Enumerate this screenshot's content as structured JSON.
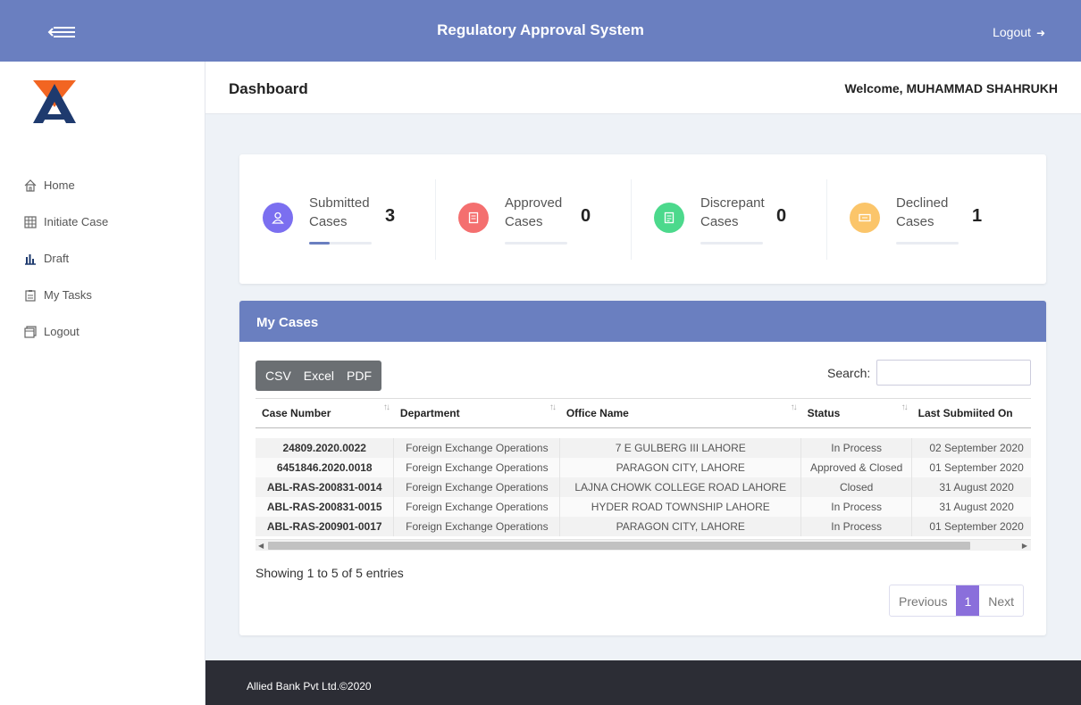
{
  "header": {
    "title": "Regulatory Approval System",
    "logout_label": "Logout"
  },
  "sidebar": {
    "items": [
      {
        "label": "Home",
        "icon": "home-icon"
      },
      {
        "label": "Initiate Case",
        "icon": "grid-icon"
      },
      {
        "label": "Draft",
        "icon": "bar-chart-icon"
      },
      {
        "label": "My Tasks",
        "icon": "clipboard-icon"
      },
      {
        "label": "Logout",
        "icon": "window-icon"
      }
    ]
  },
  "page": {
    "title": "Dashboard",
    "welcome": "Welcome, MUHAMMAD SHAHRUKH"
  },
  "stats": [
    {
      "line1": "Submitted",
      "line2": "Cases",
      "value": "3",
      "color": "#7b6ff0",
      "progress": 0.33
    },
    {
      "line1": "Approved",
      "line2": "Cases",
      "value": "0",
      "color": "#f46f6f",
      "progress": 0
    },
    {
      "line1": "Discrepant",
      "line2": "Cases",
      "value": "0",
      "color": "#4cd98c",
      "progress": 0
    },
    {
      "line1": "Declined",
      "line2": "Cases",
      "value": "1",
      "color": "#fbc56a",
      "progress": 0
    }
  ],
  "cases": {
    "title": "My Cases",
    "export_buttons": [
      "CSV",
      "Excel",
      "PDF"
    ],
    "search_label": "Search:",
    "search_value": "",
    "columns": [
      "Case Number",
      "Department",
      "Office Name",
      "Status",
      "Last Submiited On"
    ],
    "rows": [
      [
        "24809.2020.0022",
        "Foreign Exchange Operations",
        "7 E GULBERG III LAHORE",
        "In Process",
        "02 September 2020"
      ],
      [
        "6451846.2020.0018",
        "Foreign Exchange Operations",
        "PARAGON CITY, LAHORE",
        "Approved & Closed",
        "01 September 2020"
      ],
      [
        "ABL-RAS-200831-0014",
        "Foreign Exchange Operations",
        "LAJNA CHOWK COLLEGE ROAD LAHORE",
        "Closed",
        "31 August 2020"
      ],
      [
        "ABL-RAS-200831-0015",
        "Foreign Exchange Operations",
        "HYDER ROAD TOWNSHIP LAHORE",
        "In Process",
        "31 August 2020"
      ],
      [
        "ABL-RAS-200901-0017",
        "Foreign Exchange Operations",
        "PARAGON CITY, LAHORE",
        "In Process",
        "01 September 2020"
      ]
    ],
    "info": "Showing 1 to 5 of 5 entries",
    "pagination": {
      "previous": "Previous",
      "current": "1",
      "next": "Next"
    }
  },
  "footer": {
    "text": "Allied Bank Pvt Ltd.©2020"
  },
  "colors": {
    "brand": "#6a7fc0",
    "footer": "#2c2d35",
    "logo_orange": "#f26522",
    "logo_navy": "#1e3a6e"
  }
}
